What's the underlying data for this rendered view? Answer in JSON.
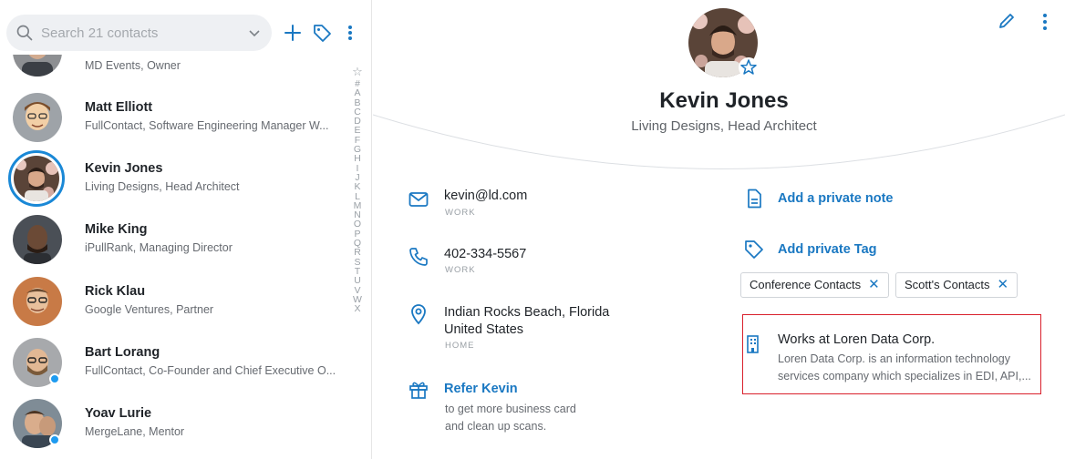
{
  "search": {
    "placeholder": "Search 21 contacts"
  },
  "contacts": [
    {
      "name": "",
      "subtitle": "MD Events, Owner"
    },
    {
      "name": "Matt Elliott",
      "subtitle": "FullContact, Software Engineering Manager W..."
    },
    {
      "name": "Kevin Jones",
      "subtitle": "Living Designs, Head Architect"
    },
    {
      "name": "Mike King",
      "subtitle": "iPullRank, Managing Director"
    },
    {
      "name": "Rick Klau",
      "subtitle": "Google Ventures, Partner"
    },
    {
      "name": "Bart Lorang",
      "subtitle": "FullContact, Co-Founder and Chief Executive O..."
    },
    {
      "name": "Yoav Lurie",
      "subtitle": "MergeLane, Mentor"
    }
  ],
  "alphabet": [
    "#",
    "A",
    "B",
    "C",
    "D",
    "E",
    "F",
    "G",
    "H",
    "I",
    "J",
    "K",
    "L",
    "M",
    "N",
    "O",
    "P",
    "Q",
    "R",
    "S",
    "T",
    "U",
    "V",
    "W",
    "X"
  ],
  "detail": {
    "name": "Kevin Jones",
    "subtitle": "Living Designs, Head Architect",
    "email": {
      "value": "kevin@ld.com",
      "label": "WORK"
    },
    "phone": {
      "value": "402-334-5567",
      "label": "WORK"
    },
    "address": {
      "line1": "Indian Rocks Beach, Florida",
      "line2": "United States",
      "label": "HOME"
    },
    "refer": {
      "title": "Refer Kevin",
      "line1": "to get more business card",
      "line2": "and clean up scans."
    },
    "note_link": "Add a private note",
    "tag_link": "Add private Tag",
    "tags": [
      "Conference Contacts",
      "Scott's Contacts"
    ],
    "company": {
      "title": "Works at Loren Data Corp.",
      "desc_line1": "Loren Data Corp. is an information technology",
      "desc_line2": "services company which specializes in EDI, API,..."
    }
  },
  "colors": {
    "accent": "#1a78c2",
    "highlight_border": "#d9202c",
    "online": "#1e9bf0"
  }
}
